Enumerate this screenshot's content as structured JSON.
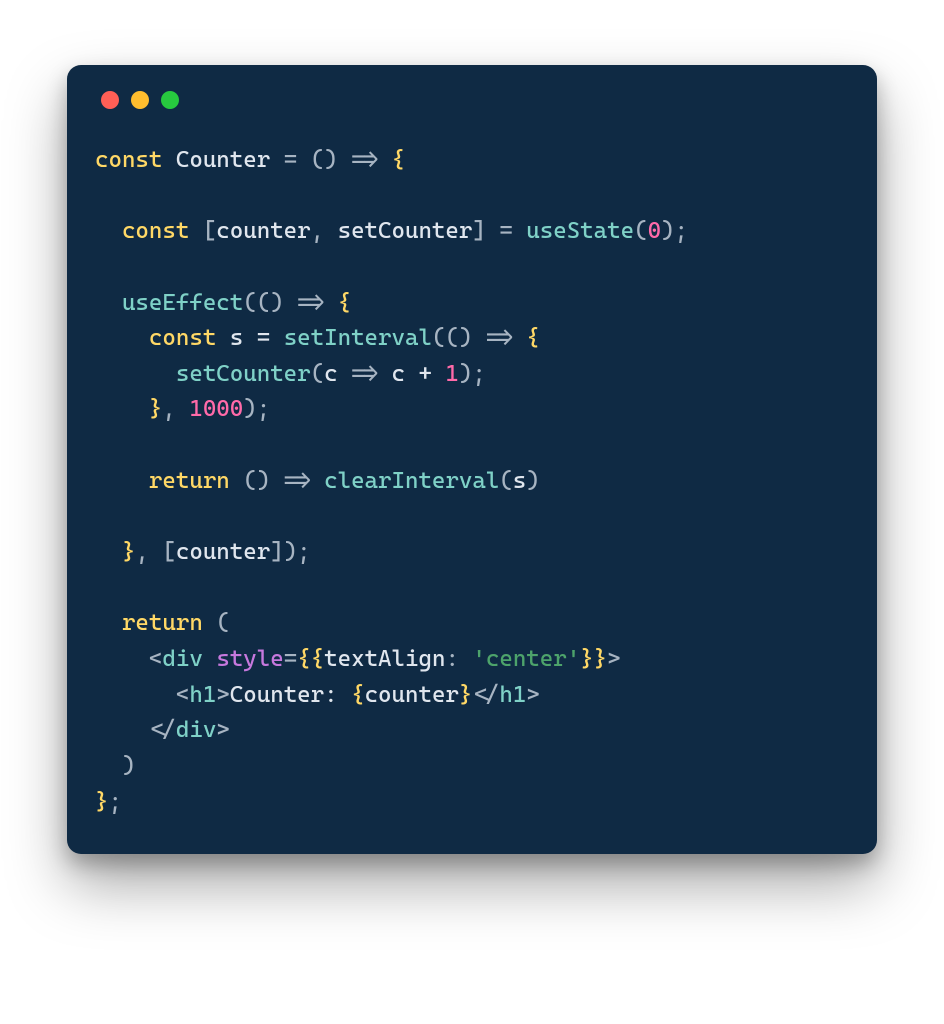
{
  "colors": {
    "background": "#0f2a44",
    "keyword": "#ffd866",
    "function": "#7fd1c7",
    "ident": "#e0e6ee",
    "number": "#ff6aa9",
    "punct": "#a7b4c2",
    "attr": "#c678dd",
    "string": "#4da36b"
  },
  "traffic": {
    "red": "#ff5f56",
    "yellow": "#ffbd2e",
    "green": "#27c93f"
  },
  "code": {
    "l1": {
      "const": "const",
      "name": "Counter",
      "eq": " = ",
      "paren": "()",
      "arrow": " => ",
      "brace": "{"
    },
    "l3": {
      "const": "const",
      "lbrack": " [",
      "a": "counter",
      "comma": ", ",
      "b": "setCounter",
      "rbrack": "] = ",
      "fn": "useState",
      "lp": "(",
      "zero": "0",
      "rp": ");"
    },
    "l5": {
      "fn": "useEffect",
      "open": "((",
      "paren": ")",
      "arrow": " => ",
      "brace": "{"
    },
    "l6": {
      "const": "const",
      "s": " s = ",
      "fn": "setInterval",
      "open": "((",
      "paren": ")",
      "arrow": " => ",
      "brace": "{"
    },
    "l7": {
      "fn": "setCounter",
      "lp": "(",
      "c": "c",
      "arrow": " => ",
      "c2": "c + ",
      "one": "1",
      "rp": ");"
    },
    "l8": {
      "close": "}, ",
      "ms": "1000",
      "end": ");"
    },
    "l10": {
      "ret": "return",
      "open": " () => ",
      "fn": "clearInterval",
      "lp": "(",
      "s": "s",
      "rp": ")"
    },
    "l12": {
      "close": "}, [",
      "dep": "counter",
      "end": "]);"
    },
    "l14": {
      "ret": "return",
      "paren": " ("
    },
    "l15": {
      "lt": "<",
      "tag": "div",
      "sp": " ",
      "attr": "style",
      "eq": "=",
      "dl": "{{",
      "key": "textAlign",
      "colon": ": ",
      "val": "'center'",
      "dr": "}}",
      "gt": ">"
    },
    "l16": {
      "lt": "<",
      "tag": "h1",
      "gt": ">",
      "text": "Counter: ",
      "bl": "{",
      "var": "counter",
      "br": "}",
      "ct": "</",
      "ctag": "h1",
      "cgt": ">"
    },
    "l17": {
      "ct": "</",
      "tag": "div",
      "gt": ">"
    },
    "l18": {
      "paren": ")"
    },
    "l19": {
      "end": "};"
    }
  }
}
